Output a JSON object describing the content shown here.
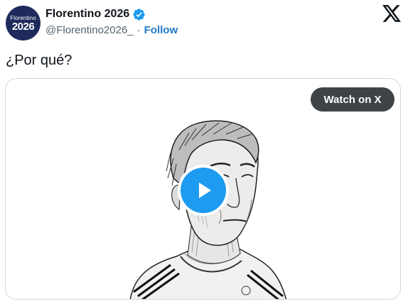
{
  "author": {
    "avatar_line1": "Florentino",
    "avatar_line2": "2026",
    "display_name": "Florentino 2026",
    "handle": "@Florentino2026_",
    "separator": "·",
    "follow_label": "Follow",
    "verified_icon": "verified-badge-icon",
    "avatar_color": "#1f2a5c",
    "verified_color": "#1d9bf0"
  },
  "tweet": {
    "text": "¿Por qué?"
  },
  "media": {
    "watch_label": "Watch on X",
    "play_icon": "play-icon",
    "play_color": "#1d9bf0"
  },
  "brand": {
    "logo_icon": "x-logo-icon"
  },
  "colors": {
    "link": "#1d79c9",
    "secondary_text": "#536471",
    "border": "#cfd9de"
  }
}
